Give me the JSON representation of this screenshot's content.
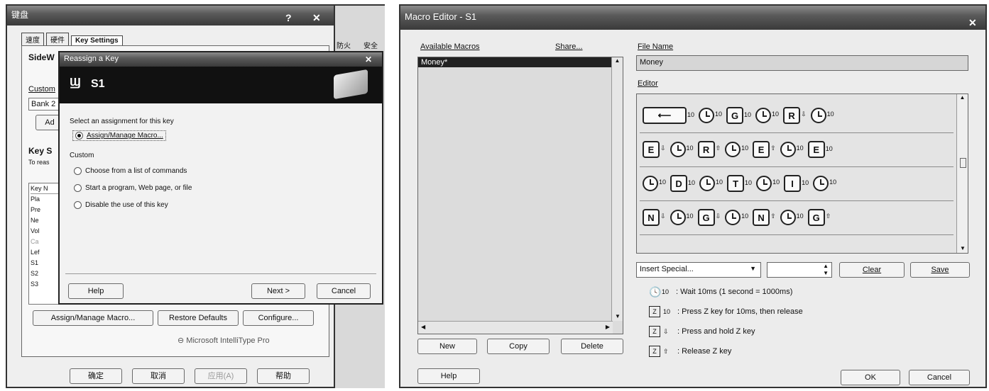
{
  "left_window": {
    "title": "键盘",
    "tabs": [
      "速度",
      "硬件",
      "Key Settings"
    ],
    "heading_partial": "SideW",
    "custom_label": "Custom",
    "bank_value": "Bank 2",
    "add_partial": "Ad",
    "key_settings_partial": "Key S",
    "to_reassign_partial": "To reas",
    "key_list_header": "Key N",
    "key_list_items": [
      "Pla",
      "Pre",
      "Ne",
      "Vol",
      "Ca",
      "Lef",
      "S1",
      "S2",
      "S3"
    ],
    "buttons": {
      "assign": "Assign/Manage Macro...",
      "restore": "Restore Defaults",
      "configure": "Configure..."
    },
    "brand": "Microsoft IntelliType Pro",
    "footer_buttons": [
      "确定",
      "取消",
      "应用(A)",
      "帮助"
    ],
    "bg_chars": [
      "防火",
      "安全"
    ]
  },
  "reassign_dialog": {
    "title": "Reassign a Key",
    "key_name": "S1",
    "prompt": "Select an assignment for this key",
    "option_macro": "Assign/Manage Macro...",
    "custom_label": "Custom",
    "options": [
      "Choose from a list of commands",
      "Start a program, Web page, or file",
      "Disable the use of this key"
    ],
    "help": "Help",
    "next": "Next >",
    "cancel": "Cancel"
  },
  "macro_editor": {
    "title": "Macro Editor - S1",
    "available_label": "Available Macros",
    "share_label": "Share...",
    "macros": [
      "Money*"
    ],
    "file_name_label": "File Name",
    "file_name_value": "Money",
    "editor_label": "Editor",
    "rows": [
      [
        {
          "t": "enter",
          "s": "10"
        },
        {
          "t": "clock",
          "s": "10"
        },
        {
          "t": "key",
          "k": "G",
          "s": "10"
        },
        {
          "t": "clock",
          "s": "10"
        },
        {
          "t": "key",
          "k": "R",
          "s": "⇩"
        },
        {
          "t": "clock",
          "s": "10"
        }
      ],
      [
        {
          "t": "key",
          "k": "E",
          "s": "⇩"
        },
        {
          "t": "clock",
          "s": "10"
        },
        {
          "t": "key",
          "k": "R",
          "s": "⇧"
        },
        {
          "t": "clock",
          "s": "10"
        },
        {
          "t": "key",
          "k": "E",
          "s": "⇧"
        },
        {
          "t": "clock",
          "s": "10"
        },
        {
          "t": "key",
          "k": "E",
          "s": "10"
        }
      ],
      [
        {
          "t": "clock",
          "s": "10"
        },
        {
          "t": "key",
          "k": "D",
          "s": "10"
        },
        {
          "t": "clock",
          "s": "10"
        },
        {
          "t": "key",
          "k": "T",
          "s": "10"
        },
        {
          "t": "clock",
          "s": "10"
        },
        {
          "t": "key",
          "k": "I",
          "s": "10"
        },
        {
          "t": "clock",
          "s": "10"
        }
      ],
      [
        {
          "t": "key",
          "k": "N",
          "s": "⇩"
        },
        {
          "t": "clock",
          "s": "10"
        },
        {
          "t": "key",
          "k": "G",
          "s": "⇩"
        },
        {
          "t": "clock",
          "s": "10"
        },
        {
          "t": "key",
          "k": "N",
          "s": "⇧"
        },
        {
          "t": "clock",
          "s": "10"
        },
        {
          "t": "key",
          "k": "G",
          "s": "⇧"
        }
      ]
    ],
    "insert_special": "Insert Special...",
    "clear": "Clear",
    "save": "Save",
    "legend": [
      {
        "icon": "clock",
        "sub": "10",
        "text": ": Wait 10ms (1 second = 1000ms)"
      },
      {
        "icon": "Z",
        "sub": "10",
        "text": ": Press Z key for 10ms, then release"
      },
      {
        "icon": "Z",
        "sub": "⇩",
        "text": ": Press and hold Z key"
      },
      {
        "icon": "Z",
        "sub": "⇧",
        "text": ": Release Z key"
      }
    ],
    "new": "New",
    "copy": "Copy",
    "delete": "Delete",
    "help": "Help",
    "ok": "OK",
    "cancel": "Cancel"
  }
}
